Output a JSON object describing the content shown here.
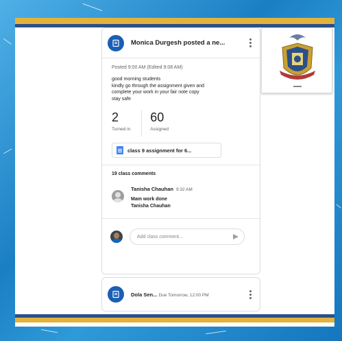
{
  "post": {
    "header_title": "Monica Durgesh posted a ne...",
    "posted_line": "Posted 9:00 AM (Edited 9:08 AM)",
    "body_lines": [
      "good morning students",
      "kindly go through the assignment given and",
      "complete your work in your fair note copy",
      "stay safe"
    ],
    "stats": [
      {
        "number": "2",
        "label": "Turned in"
      },
      {
        "number": "60",
        "label": "Assigned"
      }
    ],
    "attachment_label": "class 9 assignment for 6...",
    "comments_count": "19 class comments"
  },
  "comment": {
    "author": "Tanisha Chauhan",
    "time": "9:32 AM",
    "lines": [
      "Mam work done",
      "Tanisha Chauhan"
    ]
  },
  "reply": {
    "placeholder": "Add class comment..."
  },
  "next_post": {
    "author": "Dola Sen...",
    "meta": "Due Tomorrow, 12:00 PM"
  },
  "colors": {
    "assignment_icon": "#1a5fb4",
    "gold_bar": "#e3b23c",
    "navy_bar": "#2b4f8a",
    "background_blue": "#1e88c8"
  },
  "icons": [
    "assignment-icon",
    "more-vert-icon",
    "doc-icon",
    "send-icon",
    "school-crest-logo"
  ]
}
